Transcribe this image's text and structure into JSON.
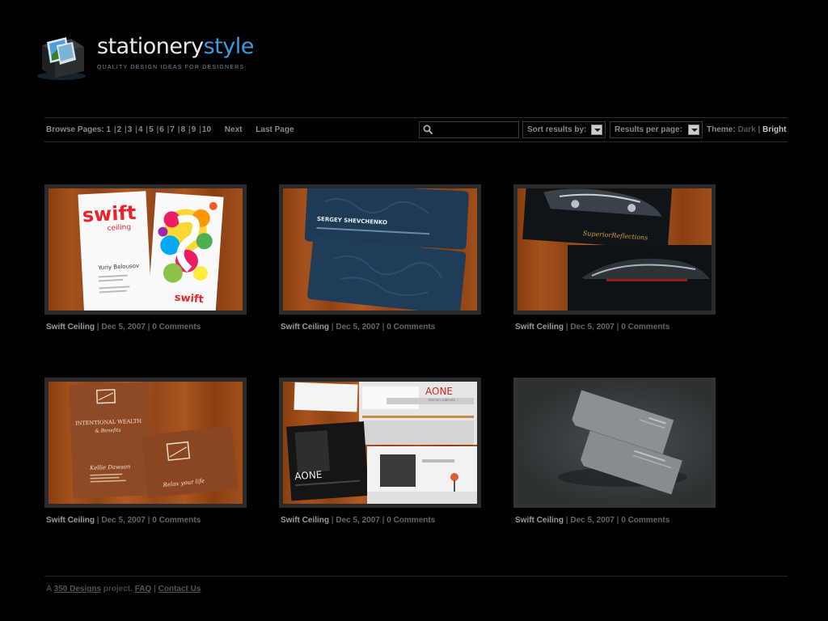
{
  "header": {
    "logo_main": "stationery",
    "logo_accent": "style",
    "tagline": "QUALITY DESIGN IDEAS FOR DESIGNERS"
  },
  "toolbar": {
    "browse_label": "Browse Pages:",
    "pages": [
      "1",
      "2",
      "3",
      "4",
      "5",
      "6",
      "7",
      "8",
      "9",
      "10"
    ],
    "next_label": "Next",
    "last_label": "Last Page",
    "search_value": "",
    "sort_label": "Sort results by:",
    "perpage_label": "Results per page:",
    "theme_label": "Theme:",
    "theme_dark": "Dark",
    "theme_bright": "Bright"
  },
  "gallery": [
    {
      "title": "Swift Ceiling",
      "date": "Dec 5, 2007",
      "comments": "0 Comments",
      "card_name": "Yuriy Belousov",
      "card_brand": "swift",
      "card_sub": "ceiling"
    },
    {
      "title": "Swift Ceiling",
      "date": "Dec 5, 2007",
      "comments": "0 Comments",
      "card_name": "SERGEY SHEVCHENKO"
    },
    {
      "title": "Swift Ceiling",
      "date": "Dec 5, 2007",
      "comments": "0 Comments",
      "card_brand": "SuperiorReflections"
    },
    {
      "title": "Swift Ceiling",
      "date": "Dec 5, 2007",
      "comments": "0 Comments",
      "card_brand": "INTENTIONAL WEALTH",
      "card_sub": "& Benefits",
      "card_name": "Kellie Dawson",
      "card_tag": "Relax your life"
    },
    {
      "title": "Swift Ceiling",
      "date": "Dec 5, 2007",
      "comments": "0 Comments",
      "card_brand": "AONE",
      "card_sub": "kitchen cabinets"
    },
    {
      "title": "Swift Ceiling",
      "date": "Dec 5, 2007",
      "comments": "0 Comments"
    }
  ],
  "footer": {
    "prefix": "A",
    "brand_link": "350 Designs",
    "mid": "project.",
    "faq": "FAQ",
    "contact": "Contact Us"
  },
  "colors": {
    "background": "#000000",
    "accent": "#3d9be0",
    "wood": "#a0501a",
    "frame": "#2b2b2b"
  }
}
